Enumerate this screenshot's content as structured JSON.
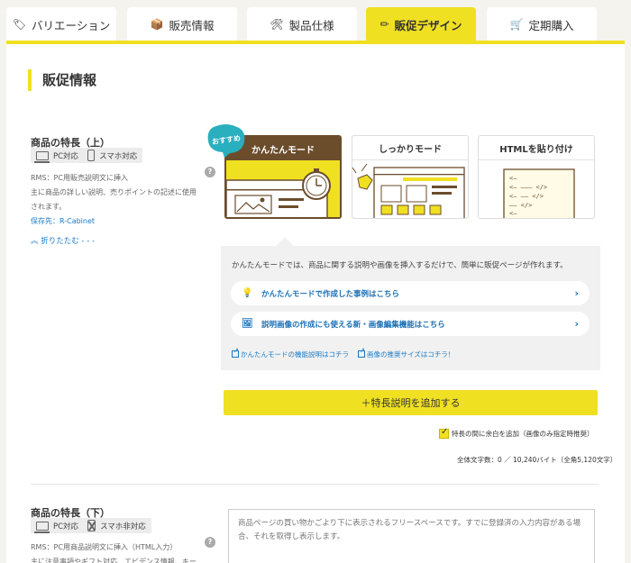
{
  "tabs": [
    {
      "label": "バリエーション",
      "icon": "tag-icon"
    },
    {
      "label": "販売情報",
      "icon": "box-icon"
    },
    {
      "label": "製品仕様",
      "icon": "tools-icon"
    },
    {
      "label": "販促デザイン",
      "icon": "pencil-icon"
    },
    {
      "label": "定期購入",
      "icon": "cart-icon"
    }
  ],
  "active_tab": 3,
  "section_title": "販促情報",
  "upper": {
    "label": "商品の特長（上）",
    "badge_pc": "PC対応",
    "badge_sp": "スマホ対応",
    "desc1": "RMS：PC用販売説明文に挿入",
    "desc2": "主に商品の詳しい説明、売りポイントの記述に使用されます。",
    "save_to": "保存先：R-Cabinet",
    "collapse": "折りたたむ - - -"
  },
  "modes": {
    "recommend": "おすすめ",
    "easy": "かんたんモード",
    "full": "しっかりモード",
    "html": "HTMLを貼り付け"
  },
  "info": {
    "text": "かんたんモードでは、商品に関する説明や画像を挿入するだけで、簡単に販促ページが作れます。",
    "link1": "かんたんモードで作成した事例はこちら",
    "link2": "説明画像の作成にも使える新・画像編集機能はこちら",
    "small1": "かんたんモードの機能説明はコチラ",
    "small2": "画像の推奨サイズはコチラ！"
  },
  "add_button": "＋特長説明を追加する",
  "checkbox_label": "特長の間に余白を追加（画像のみ指定時推奨）",
  "char_count": "全体文字数：0 ／ 10,240バイト（全角5,120文字）",
  "lower": {
    "label": "商品の特長（下）",
    "badge_pc": "PC対応",
    "badge_sp": "スマホ非対応",
    "desc1": "RMS：PC用商品説明文に挿入（HTML入力）",
    "desc2": "主に注意事項やギフト対応、エビデンス情報、キーワー",
    "placeholder": "商品ページの買い物かごより下に表示されるフリースペースです。すでに登録済の入力内容がある場合、それを取得し表示します。"
  },
  "colors": {
    "accent": "#f0e022",
    "brown": "#6b4d2c",
    "link": "#1a7ac7"
  }
}
